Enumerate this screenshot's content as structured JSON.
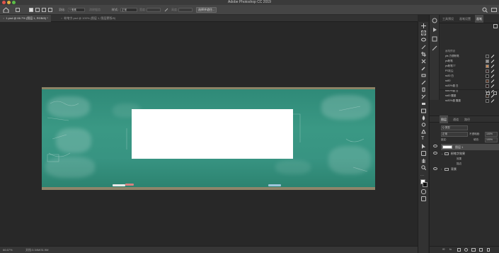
{
  "window": {
    "title": "Adobe Photoshop CC 2019"
  },
  "options_bar": {
    "feather_label": "羽化:",
    "feather_value": "0 像素",
    "antialias_label": "消除锯齿",
    "style_label": "样式:",
    "style_value": "正常",
    "width_label": "宽度:",
    "height_label": "高度:",
    "select_mask_button": "选择并遮住..."
  },
  "tabs": [
    {
      "label": "1.psd @ 66.7% (图层 1, RGB/8) *",
      "active": true
    },
    {
      "label": "粉笔字.psd @ 100% (图层 1, 图层蒙版/8)",
      "active": false
    }
  ],
  "status_bar": {
    "zoom": "66.67%",
    "doc_info": "文档:3.34M/31.9M"
  },
  "panel": {
    "top_tabs": [
      "工具预设",
      "画笔设置",
      "画笔"
    ],
    "presets_title": "画笔预设",
    "presets": [
      {
        "name": "pts 方便粉笔",
        "color": "#2d2d2d"
      },
      {
        "name": "ps粉笔",
        "color": "#9a9a9a"
      },
      {
        "name": "ps粉笔77",
        "color": "#c98a57"
      },
      {
        "name": "PS灰尘",
        "color": "#3a2a2a"
      },
      {
        "name": "ss30 白",
        "color": "#1d1d1d"
      },
      {
        "name": "ss50",
        "color": "#5a3a2a"
      },
      {
        "name": "ss30%墨 白",
        "color": "#2a1a1a"
      },
      {
        "name": "ss50%墨 白",
        "color": "#1a1a1a"
      },
      {
        "name": "ss60 醒墨",
        "color": "#3a2a20"
      },
      {
        "name": "ss30%墨 醒墨",
        "color": "#222222"
      }
    ],
    "layer_tabs": [
      "图层",
      "通道",
      "路径"
    ],
    "kind_label": "Q 类型",
    "blend_mode": "正常",
    "opacity_label": "不透明度:",
    "opacity_value": "100%",
    "lock_label": "锁定:",
    "fill_label": "填充:",
    "fill_value": "100%",
    "layers": [
      {
        "name": "图层 1",
        "kind": "layer"
      },
      {
        "name": "粉笔字效果",
        "kind": "group"
      },
      {
        "name": "效果",
        "kind": "sub"
      },
      {
        "name": "描边",
        "kind": "sub"
      },
      {
        "name": "背景",
        "kind": "group"
      }
    ],
    "bottom_icons": [
      "link-icon",
      "fx-icon",
      "mask-icon",
      "adjust-icon",
      "folder-icon",
      "new-layer-icon",
      "trash-icon"
    ]
  }
}
